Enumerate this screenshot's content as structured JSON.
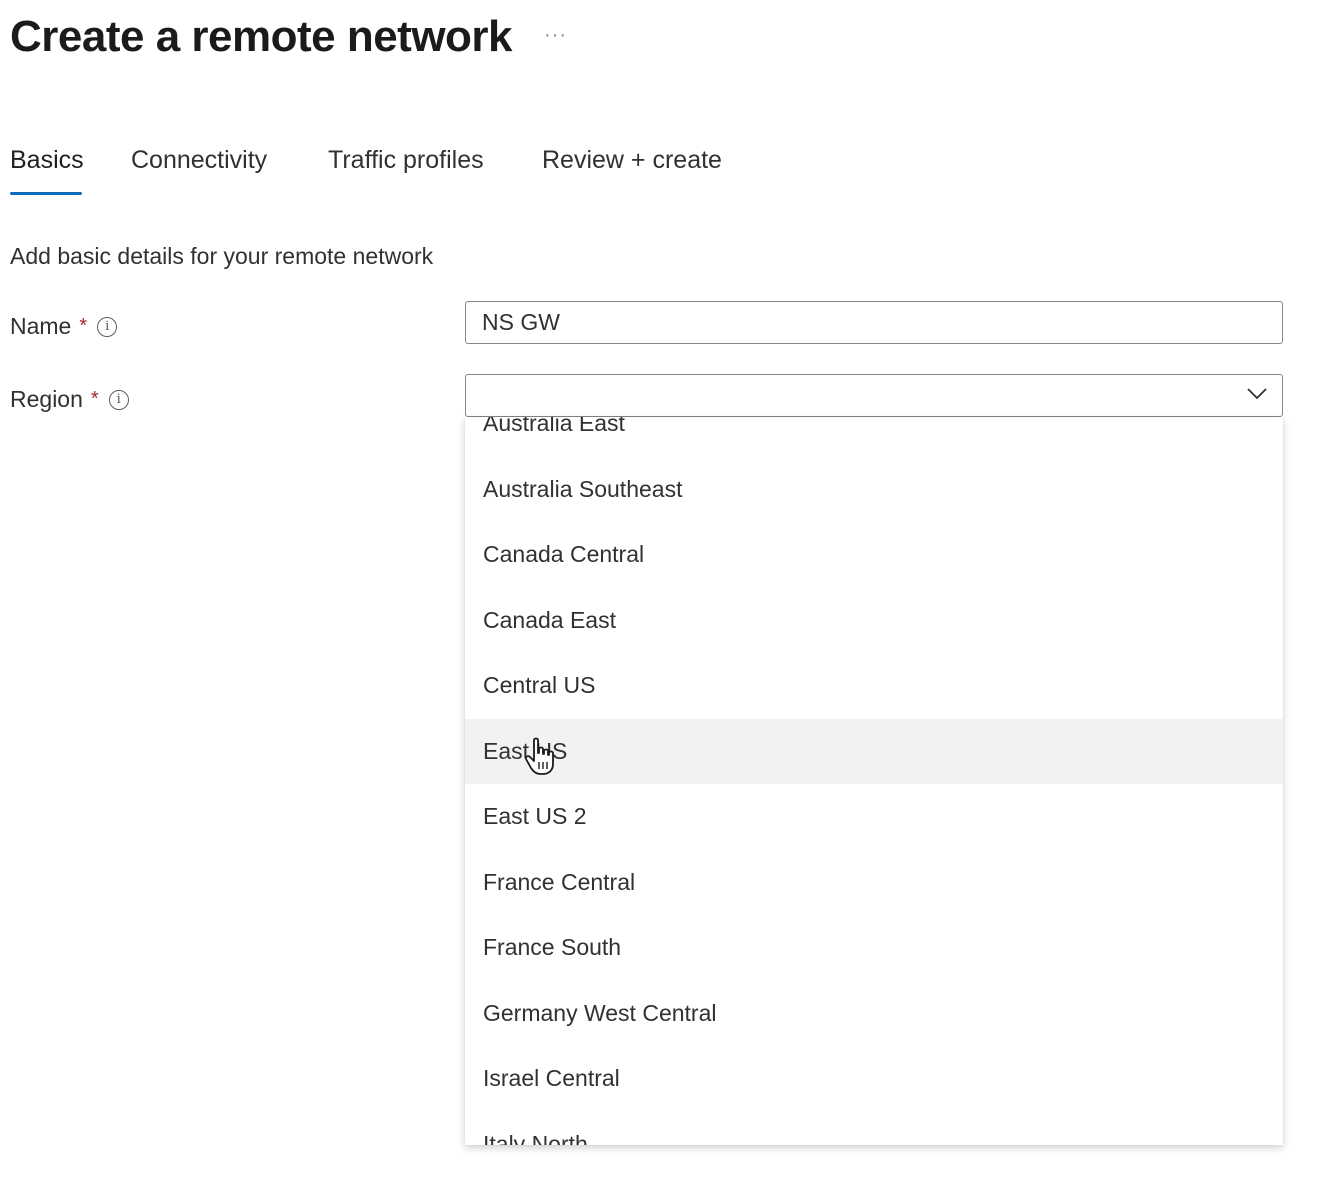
{
  "page": {
    "title": "Create a remote network",
    "more_icon": "more-icon",
    "more_label": "···"
  },
  "tabs": [
    {
      "label": "Basics",
      "active": true
    },
    {
      "label": "Connectivity",
      "active": false
    },
    {
      "label": "Traffic profiles",
      "active": false
    },
    {
      "label": "Review + create",
      "active": false
    }
  ],
  "form": {
    "subtitle": "Add basic details for your remote network",
    "name": {
      "label": "Name",
      "required_mark": "*",
      "value": "NS GW",
      "icon": "info-icon"
    },
    "region": {
      "label": "Region",
      "required_mark": "*",
      "value": "",
      "icon": "info-icon",
      "chevron_icon": "chevron-down-icon"
    }
  },
  "region_dropdown": {
    "options": [
      "Australia East",
      "Australia Southeast",
      "Canada Central",
      "Canada East",
      "Central US",
      "East US",
      "East US 2",
      "France Central",
      "France South",
      "Germany West Central",
      "Israel Central",
      "Italy North"
    ],
    "hovered": "East US",
    "cursor_icon": "hand-cursor-icon"
  },
  "colors": {
    "accent": "#0f6cbd",
    "required": "#a4262c",
    "hover_bg": "#f3f2f1",
    "border": "#8a8886"
  }
}
